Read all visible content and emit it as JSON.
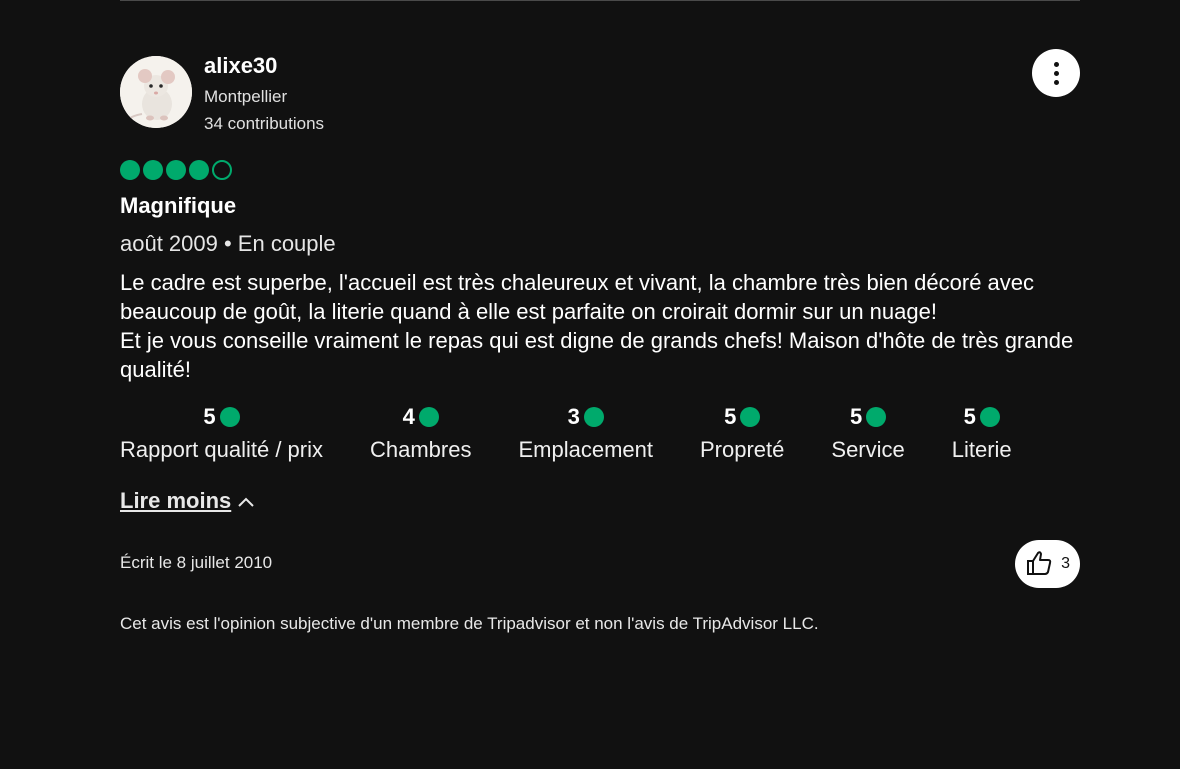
{
  "author": {
    "name": "alixe30",
    "location": "Montpellier",
    "contributions": "34 contributions"
  },
  "rating": {
    "value": 4,
    "max": 5
  },
  "review": {
    "title": "Magnifique",
    "date_type": "août 2009 • En couple",
    "body": "Le cadre est superbe, l'accueil est très chaleureux et vivant, la chambre très bien décoré avec beaucoup de goût, la literie quand à elle est parfaite on croirait dormir sur un nuage!\nEt je vous conseille vraiment le repas qui est digne de grands chefs! Maison d'hôte de très grande qualité!"
  },
  "sub_ratings": [
    {
      "value": "5",
      "label": "Rapport qualité / prix"
    },
    {
      "value": "4",
      "label": "Chambres"
    },
    {
      "value": "3",
      "label": "Emplacement"
    },
    {
      "value": "5",
      "label": "Propreté"
    },
    {
      "value": "5",
      "label": "Service"
    },
    {
      "value": "5",
      "label": "Literie"
    }
  ],
  "read_less_label": "Lire moins",
  "written_date": "Écrit le 8 juillet 2010",
  "helpful_count": "3",
  "disclaimer": "Cet avis est l'opinion subjective d'un membre de Tripadvisor et non l'avis de TripAdvisor LLC.",
  "colors": {
    "accent": "#00aa6c",
    "background": "#111111"
  },
  "icons": {
    "more": "more-vertical-icon",
    "helpful": "thumbs-up-icon",
    "read_less": "chevron-up-icon"
  }
}
